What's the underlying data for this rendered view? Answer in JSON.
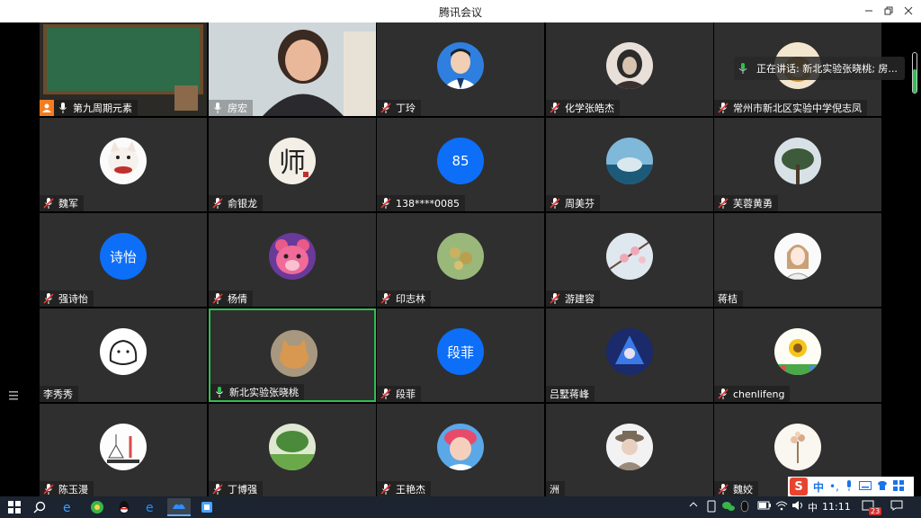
{
  "window": {
    "title": "腾讯会议"
  },
  "speaking": {
    "label": "正在讲话: 新北实验张晓桃; 房..."
  },
  "volume_level": 0.6,
  "participants": [
    {
      "name": "第九周期元素",
      "avatar": "video-blackboard",
      "host": true
    },
    {
      "name": "房宏",
      "avatar": "video-person"
    },
    {
      "name": "丁玲",
      "avatar": "photo-man"
    },
    {
      "name": "化学张皓杰",
      "avatar": "photo-anime"
    },
    {
      "name": "常州市新北区实验中学倪志凤",
      "avatar": "photo-dog"
    },
    {
      "name": "魏军",
      "avatar": "photo-cat"
    },
    {
      "name": "俞银龙",
      "avatar": "photo-calligraphy"
    },
    {
      "name": "138****0085",
      "avatar_text": "85"
    },
    {
      "name": "周美芬",
      "avatar": "photo-sea"
    },
    {
      "name": "芙蓉黄勇",
      "avatar": "photo-tree"
    },
    {
      "name": "强诗怡",
      "avatar_text": "诗怡"
    },
    {
      "name": "杨倩",
      "avatar": "photo-bear"
    },
    {
      "name": "印志林",
      "avatar": "photo-plant"
    },
    {
      "name": "游建容",
      "avatar": "photo-blossom"
    },
    {
      "name": "蒋桔",
      "avatar": "photo-girl-sketch",
      "mic_hidden": true
    },
    {
      "name": "李秀秀",
      "avatar": "photo-cat-sketch",
      "mic_hidden": true
    },
    {
      "name": "新北实验张晓桃",
      "avatar": "photo-cat-orange",
      "active": true
    },
    {
      "name": "段菲",
      "avatar_text": "段菲"
    },
    {
      "name": "吕墅蒋峰",
      "avatar": "photo-game",
      "mic_hidden": true
    },
    {
      "name": "chenlifeng",
      "avatar": "photo-sunflower"
    },
    {
      "name": "陈玉漫",
      "avatar": "photo-science"
    },
    {
      "name": "丁博强",
      "avatar": "photo-garden"
    },
    {
      "name": "王艳杰",
      "avatar": "photo-kid"
    },
    {
      "name": "洲",
      "avatar": "photo-hat",
      "mic_hidden": true
    },
    {
      "name": "魏姣",
      "avatar": "photo-flower"
    }
  ],
  "ime": {
    "logo": "S",
    "lang": "中"
  },
  "taskbar": {
    "time": "11:11",
    "lang": "中",
    "notifications": "23"
  },
  "colors": {
    "avatar_blue": "#0d6ef8",
    "active_border": "#2fbf52",
    "tile_bg": "#2f2f2f"
  }
}
